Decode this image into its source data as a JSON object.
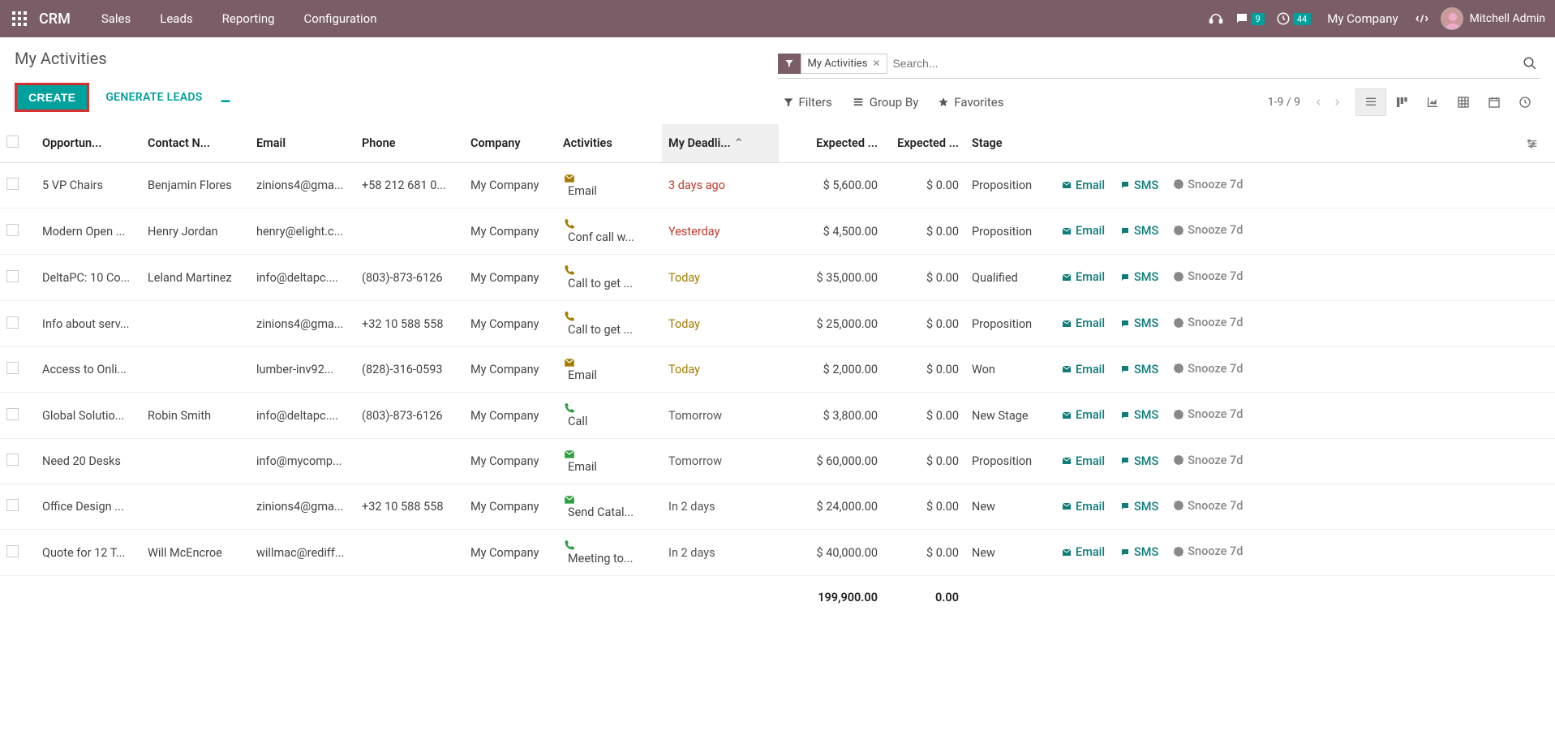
{
  "navbar": {
    "brand": "CRM",
    "menu": [
      "Sales",
      "Leads",
      "Reporting",
      "Configuration"
    ],
    "messages_badge": "9",
    "activities_badge": "44",
    "company": "My Company",
    "user": "Mitchell Admin"
  },
  "header": {
    "title": "My Activities",
    "create": "CREATE",
    "generate": "GENERATE LEADS"
  },
  "search": {
    "facet_label": "My Activities",
    "placeholder": "Search..."
  },
  "toolbar": {
    "filters": "Filters",
    "group_by": "Group By",
    "favorites": "Favorites",
    "pager": "1-9 / 9"
  },
  "columns": {
    "opportunity": "Opportun...",
    "contact": "Contact N...",
    "email": "Email",
    "phone": "Phone",
    "company": "Company",
    "activities": "Activities",
    "deadline": "My Deadli...",
    "expected_rev": "Expected ...",
    "expected_mrr": "Expected ...",
    "stage": "Stage"
  },
  "row_actions": {
    "email": "Email",
    "sms": "SMS",
    "snooze": "Snooze 7d"
  },
  "rows": [
    {
      "opportunity": "5 VP Chairs",
      "contact": "Benjamin Flores",
      "email": "zinions4@gma...",
      "phone": "+58 212 681 0...",
      "company": "My Company",
      "activity_icon": "email-due",
      "activity": "Email",
      "deadline": "3 days ago",
      "deadline_cls": "deadline-overdue",
      "rev": "$ 5,600.00",
      "mrr": "$ 0.00",
      "stage": "Proposition"
    },
    {
      "opportunity": "Modern Open ...",
      "contact": "Henry Jordan",
      "email": "henry@elight.c...",
      "phone": "",
      "company": "My Company",
      "activity_icon": "call-due",
      "activity": "Conf call w...",
      "deadline": "Yesterday",
      "deadline_cls": "deadline-overdue",
      "rev": "$ 4,500.00",
      "mrr": "$ 0.00",
      "stage": "Proposition"
    },
    {
      "opportunity": "DeltaPC: 10 Co...",
      "contact": "Leland Martinez",
      "email": "info@deltapc....",
      "phone": "(803)-873-6126",
      "company": "My Company",
      "activity_icon": "call-due",
      "activity": "Call to get ...",
      "deadline": "Today",
      "deadline_cls": "deadline-today",
      "rev": "$ 35,000.00",
      "mrr": "$ 0.00",
      "stage": "Qualified"
    },
    {
      "opportunity": "Info about serv...",
      "contact": "",
      "email": "zinions4@gma...",
      "phone": "+32 10 588 558",
      "company": "My Company",
      "activity_icon": "call-due",
      "activity": "Call to get ...",
      "deadline": "Today",
      "deadline_cls": "deadline-today",
      "rev": "$ 25,000.00",
      "mrr": "$ 0.00",
      "stage": "Proposition"
    },
    {
      "opportunity": "Access to Onli...",
      "contact": "",
      "email": "lumber-inv92...",
      "phone": "(828)-316-0593",
      "company": "My Company",
      "activity_icon": "email-due",
      "activity": "Email",
      "deadline": "Today",
      "deadline_cls": "deadline-today",
      "rev": "$ 2,000.00",
      "mrr": "$ 0.00",
      "stage": "Won"
    },
    {
      "opportunity": "Global Solutio...",
      "contact": "Robin Smith",
      "email": "info@deltapc....",
      "phone": "(803)-873-6126",
      "company": "My Company",
      "activity_icon": "call-ok",
      "activity": "Call",
      "deadline": "Tomorrow",
      "deadline_cls": "deadline-future",
      "rev": "$ 3,800.00",
      "mrr": "$ 0.00",
      "stage": "New Stage"
    },
    {
      "opportunity": "Need 20 Desks",
      "contact": "",
      "email": "info@mycomp...",
      "phone": "",
      "company": "My Company",
      "activity_icon": "email-ok",
      "activity": "Email",
      "deadline": "Tomorrow",
      "deadline_cls": "deadline-future",
      "rev": "$ 60,000.00",
      "mrr": "$ 0.00",
      "stage": "Proposition"
    },
    {
      "opportunity": "Office Design ...",
      "contact": "",
      "email": "zinions4@gma...",
      "phone": "+32 10 588 558",
      "company": "My Company",
      "activity_icon": "email-ok",
      "activity": "Send Catal...",
      "deadline": "In 2 days",
      "deadline_cls": "deadline-future",
      "rev": "$ 24,000.00",
      "mrr": "$ 0.00",
      "stage": "New"
    },
    {
      "opportunity": "Quote for 12 T...",
      "contact": "Will McEncroe",
      "email": "willmac@rediff...",
      "phone": "",
      "company": "My Company",
      "activity_icon": "call-ok",
      "activity": "Meeting to...",
      "deadline": "In 2 days",
      "deadline_cls": "deadline-future",
      "rev": "$ 40,000.00",
      "mrr": "$ 0.00",
      "stage": "New"
    }
  ],
  "totals": {
    "rev": "199,900.00",
    "mrr": "0.00"
  }
}
